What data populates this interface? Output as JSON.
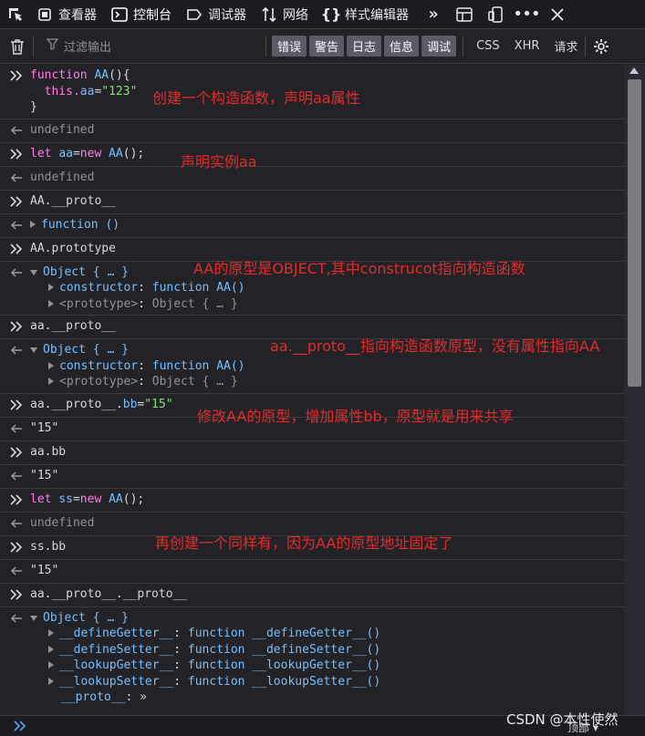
{
  "tabs": [
    {
      "label": "查看器",
      "icon": "inspector-icon"
    },
    {
      "label": "控制台",
      "icon": "console-icon",
      "active": true
    },
    {
      "label": "调试器",
      "icon": "debugger-icon"
    },
    {
      "label": "网络",
      "icon": "network-icon"
    },
    {
      "label": "样式编辑器",
      "icon": "style-editor-icon"
    }
  ],
  "toolbar": {
    "filter_placeholder": "过滤输出",
    "levels": [
      "错误",
      "警告",
      "日志",
      "信息",
      "调试"
    ],
    "requests": [
      "CSS",
      "XHR",
      "请求"
    ]
  },
  "console": {
    "undefined": "undefined",
    "m1": {
      "l1a": "function ",
      "l1b": "AA",
      "l1c": "(){",
      "l2a": "  this.",
      "l2b": "aa",
      "l2c": "=",
      "l2d": "\"123\"",
      "l3": "}"
    },
    "m2": {
      "a": "let ",
      "b": "aa",
      "c": "=",
      "d": "new ",
      "e": "AA",
      "f": "();"
    },
    "m3": {
      "input": "AA.__proto__",
      "result": "function ()"
    },
    "m4": {
      "input": "AA.prototype",
      "obj": "Object { … }",
      "k1": "constructor",
      "v1": "function AA()",
      "k2": "<prototype>",
      "v2": "Object { … }"
    },
    "m5": {
      "input": "aa.__proto__",
      "obj": "Object { … }",
      "k1": "constructor",
      "v1": "function AA()",
      "k2": "<prototype>",
      "v2": "Object { … }"
    },
    "m6": {
      "a": "aa",
      "b": ".__proto__.",
      "c": "bb",
      "d": "=",
      "e": "\"15\"",
      "result": "\"15\""
    },
    "m7": {
      "input": "aa.bb",
      "result": "\"15\""
    },
    "m8": {
      "a": "let ",
      "b": "ss",
      "c": "=",
      "d": "new ",
      "e": "AA",
      "f": "();"
    },
    "m9": {
      "input": "ss.bb",
      "result": "\"15\""
    },
    "m10": {
      "input": "aa.__proto__.__proto__",
      "obj": "Object { … }",
      "props": [
        {
          "k": "__defineGetter__",
          "v": "function __defineGetter__()"
        },
        {
          "k": "__defineSetter__",
          "v": "function __defineSetter__()"
        },
        {
          "k": "__lookupGetter__",
          "v": "function __lookupGetter__()"
        },
        {
          "k": "__lookupSetter__",
          "v": "function __lookupSetter__()"
        }
      ],
      "last_k": "__proto__",
      "last_v": "»"
    }
  },
  "annotations": {
    "a1": "创建一个构造函数，声明aa属性",
    "a2": "声明实例aa",
    "a3": "AA的原型是OBJECT,其中construcot指向构造函数",
    "a4": "aa.__proto__指向构造函数原型，没有属性指向AA",
    "a5": "修改AA的原型，增加属性bb，原型就是用来共享",
    "a6": "再创建一个同样有，因为AA的原型地址固定了"
  },
  "watermark": "CSDN @本性使然",
  "top_button": "顶部",
  "colors": {
    "annotation": "#e22b2b",
    "keyword": "#ff7de9",
    "string": "#86de74",
    "function": "#75bfff"
  }
}
